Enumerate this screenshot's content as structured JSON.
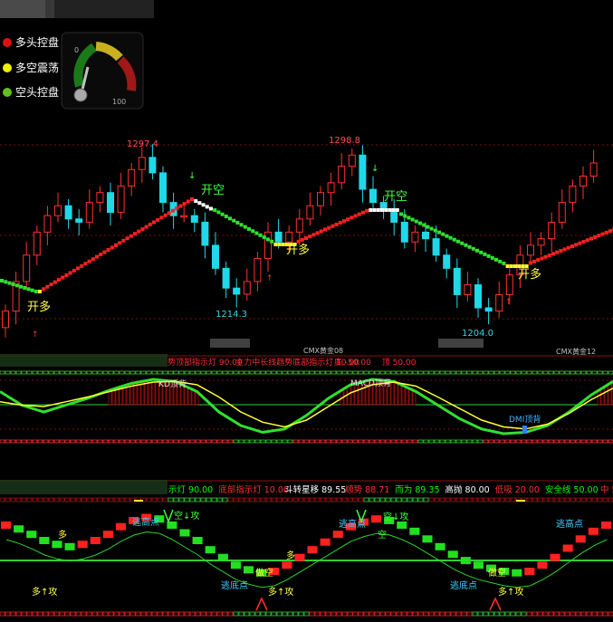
{
  "header": {
    "labels": [
      "",
      "",
      ""
    ],
    "legend": [
      {
        "label": "多头控盘",
        "color": "#e01010"
      },
      {
        "label": "多空震荡",
        "color": "#f0f000"
      },
      {
        "label": "空头控盘",
        "color": "#60c020"
      }
    ],
    "gauge": {
      "min": "0",
      "max": "100",
      "value_fraction": 0.05
    }
  },
  "main": {
    "price_high_1": "1297.4",
    "price_high_2": "1298.8",
    "price_low_1": "1214.3",
    "price_low_2": "1204.0",
    "open_long": "开多",
    "open_short": "开空",
    "contract_labels": [
      "CMX黄金08",
      "CMX黄金12"
    ],
    "blurred_labels": [
      "",
      ""
    ]
  },
  "panel2": {
    "indicators": [
      {
        "label": "势顶部指示灯 90.00",
        "color": "#ff3030"
      },
      {
        "label": "主力中长线趋势底部指示灯 10.00",
        "color": "#ff3030"
      },
      {
        "label": "底 -50.00",
        "color": "#ff3030"
      },
      {
        "label": "顶 50.00",
        "color": "#ff3030"
      }
    ],
    "annotations": [
      "KD顶背",
      "MACD顶背",
      "DMI顶背"
    ]
  },
  "panel3": {
    "indicators": [
      {
        "label": "示灯 90.00",
        "color": "#00ff00"
      },
      {
        "label": "底部指示灯 10.00",
        "color": "#ff3030"
      },
      {
        "label": "斗转星移 89.55",
        "color": "#ffffff"
      },
      {
        "label": "顺势 88.71",
        "color": "#ff3030"
      },
      {
        "label": "而为 89.35",
        "color": "#00ff00"
      },
      {
        "label": "高抛 80.00",
        "color": "#ffffff"
      },
      {
        "label": "低吸 20.00",
        "color": "#ff3030"
      },
      {
        "label": "安全线 50.00",
        "color": "#00ff00"
      },
      {
        "label": "中 5",
        "color": "#ff3030"
      }
    ],
    "annotations": {
      "escape_top": "逃高点",
      "escape_bottom": "逃底点",
      "bull": "多",
      "bear": "空",
      "hold_short": "做空",
      "short_attack": "空↓攻",
      "long_attack": "多↑攻"
    }
  },
  "chart_data": [
    {
      "type": "candlestick",
      "title": "",
      "series": [
        {
          "name": "",
          "values": [
            1204,
            1222,
            1238,
            1252,
            1262,
            1268,
            1260,
            1258,
            1270,
            1276,
            1264,
            1280,
            1290,
            1297.4,
            1288,
            1270,
            1262,
            1262,
            1258,
            1244,
            1230,
            1218,
            1214.3,
            1222,
            1236,
            1252,
            1246,
            1252,
            1260,
            1268,
            1276,
            1282,
            1292,
            1298.8,
            1278,
            1270,
            1266,
            1258,
            1246,
            1252,
            1248,
            1238,
            1230,
            1214,
            1220,
            1206,
            1204,
            1214,
            1226,
            1238,
            1244,
            1248,
            1258,
            1270,
            1280,
            1286,
            1294
          ]
        }
      ],
      "annotations": [
        "1297.4",
        "1298.8",
        "1214.3",
        "1204.0"
      ]
    },
    {
      "type": "line",
      "series": [
        {
          "name": "",
          "values": [
            70,
            50,
            40,
            50,
            60,
            72,
            82,
            88,
            85,
            70,
            40,
            20,
            10,
            15,
            35,
            60,
            80,
            88,
            85,
            70,
            50,
            30,
            15,
            8,
            10,
            20,
            40,
            65,
            85
          ]
        },
        {
          "name": "",
          "values": [
            55,
            50,
            48,
            55,
            62,
            70,
            78,
            84,
            85,
            80,
            62,
            40,
            25,
            18,
            28,
            48,
            68,
            80,
            84,
            78,
            62,
            45,
            28,
            18,
            15,
            22,
            38,
            58,
            75
          ]
        }
      ],
      "ylim": [
        0,
        100
      ]
    },
    {
      "type": "bar",
      "series": [
        {
          "name": "",
          "values": [
            80,
            75,
            68,
            60,
            55,
            52,
            55,
            60,
            68,
            78,
            86,
            90,
            88,
            80,
            70,
            60,
            48,
            38,
            28,
            22,
            18,
            20,
            28,
            38,
            48,
            58,
            68,
            78,
            84,
            88,
            86,
            80,
            72,
            62,
            52,
            42,
            34,
            28,
            24,
            20,
            18,
            20,
            28,
            38,
            50,
            62,
            72,
            80
          ]
        }
      ],
      "ylim": [
        0,
        100
      ]
    }
  ]
}
